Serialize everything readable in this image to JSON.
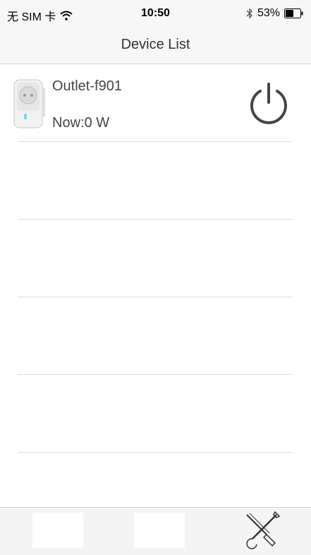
{
  "status_bar": {
    "carrier": "无 SIM 卡",
    "time": "10:50",
    "battery_percent": "53%",
    "battery_level": 0.53,
    "icons": [
      "wifi-icon",
      "bluetooth-icon",
      "battery-icon"
    ]
  },
  "navbar": {
    "title": "Device List"
  },
  "devices": [
    {
      "name": "Outlet-f901",
      "power": "Now:0 W",
      "icon": "outlet-plug-icon",
      "power_button_icon": "power-icon"
    }
  ],
  "tab_bar": {
    "tabs": [
      {
        "icon": "blank-tab"
      },
      {
        "icon": "blank-tab"
      },
      {
        "icon": "tools-icon"
      }
    ]
  },
  "colors": {
    "bar_background": "#f7f7f7",
    "separator": "#dcdcdc",
    "text": "#444444",
    "power_icon": "#444444"
  }
}
